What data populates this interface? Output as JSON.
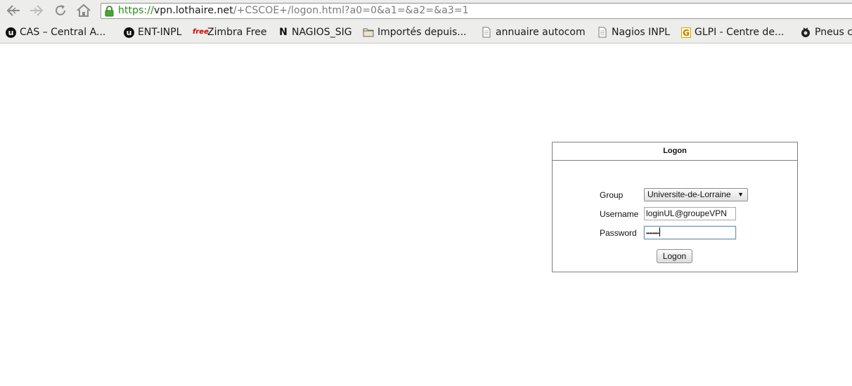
{
  "browser": {
    "url": {
      "scheme": "https://",
      "host": "vpn.lothaire.net",
      "path": "/+CSCOE+/logon.html?a0=0&a1=&a2=&a3=1"
    },
    "bookmarks": [
      {
        "label": "CAS – Central A...",
        "icon": "universite-lorraine-icon"
      },
      {
        "label": "ENT-INPL",
        "icon": "universite-lorraine-icon"
      },
      {
        "label": "Zimbra Free",
        "icon": "free-icon",
        "icon_text": "free"
      },
      {
        "label": "NAGIOS_SIG",
        "icon": "nagios-icon",
        "icon_text": "N"
      },
      {
        "label": "Importés depuis...",
        "icon": "folder-icon"
      },
      {
        "label": "annuaire autocom",
        "icon": "page-icon"
      },
      {
        "label": "Nagios INPL",
        "icon": "page-icon"
      },
      {
        "label": "GLPI - Centre de...",
        "icon": "glpi-icon",
        "icon_text": "G"
      },
      {
        "label": "Pneus c",
        "icon": "tire-icon"
      }
    ],
    "ul_logo_text": "u"
  },
  "logon": {
    "title": "Logon",
    "group_label": "Group",
    "group_value": "Universite-de-Lorraine",
    "username_label": "Username",
    "username_value": "loginUL@groupeVPN",
    "password_label": "Password",
    "password_value": "••••••••",
    "button_label": "Logon"
  },
  "colors": {
    "scheme_green": "#2a8a1a",
    "toolbar_bg": "#ededec",
    "panel_border": "#7f7f7f"
  }
}
